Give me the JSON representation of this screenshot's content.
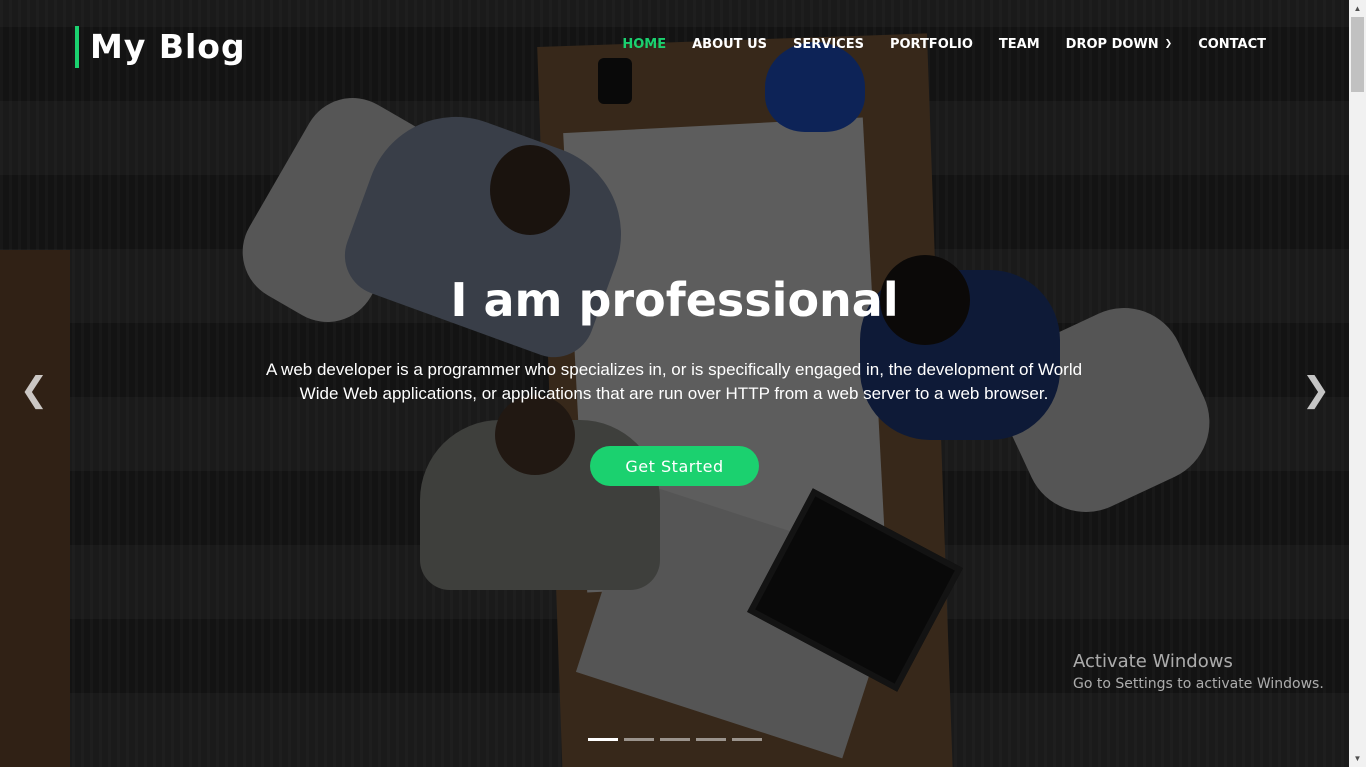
{
  "header": {
    "logo": "My Blog",
    "nav": [
      {
        "label": "HOME",
        "active": true
      },
      {
        "label": "ABOUT US"
      },
      {
        "label": "SERVICES"
      },
      {
        "label": "PORTFOLIO"
      },
      {
        "label": "TEAM"
      },
      {
        "label": "DROP DOWN",
        "icon": "chevron-down-icon"
      },
      {
        "label": "CONTACT"
      }
    ]
  },
  "hero": {
    "title": "I am professional",
    "description": "A web developer is a programmer who specializes in, or is specifically engaged in, the development of World Wide Web applications, or applications that are run over HTTP from a web server to a web browser.",
    "cta": "Get Started",
    "prev_icon": "chevron-left-icon",
    "next_icon": "chevron-right-icon",
    "slide_count": 5,
    "active_slide": 1
  },
  "watermark": {
    "line1": "Activate Windows",
    "line2": "Go to Settings to activate Windows."
  },
  "colors": {
    "accent": "#1bd16f"
  }
}
